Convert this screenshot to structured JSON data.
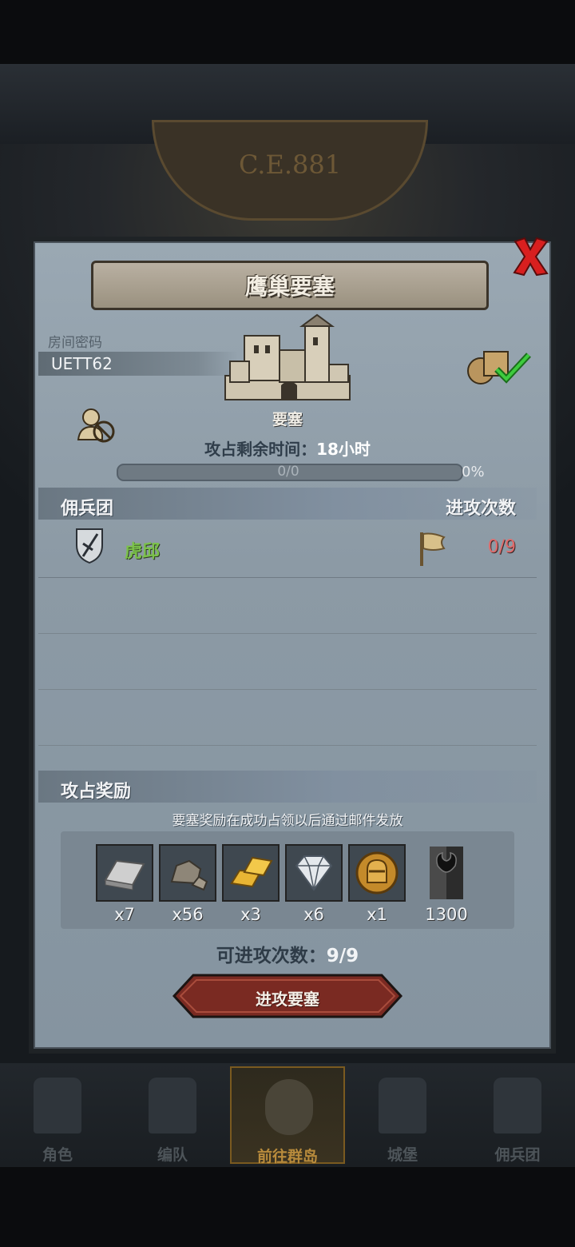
{
  "background": {
    "era_label": "C.E.881"
  },
  "dialog": {
    "title": "鹰巢要塞",
    "room_code_label": "房间密码",
    "room_code": "UETT62",
    "target_name": "要塞",
    "time_left_label": "攻占剩余时间：",
    "time_left_value": "18小时",
    "progress_count": "0/0",
    "progress_percent": "0%",
    "progress_fraction": 0,
    "mercenary_header": "佣兵团",
    "attacks_header": "进攻次数",
    "mercenaries": [
      {
        "name": "虎邱",
        "attacks": "0/9"
      }
    ],
    "rewards_header": "攻占奖励",
    "reward_note": "要塞奖励在成功占领以后通过邮件发放",
    "rewards": [
      {
        "icon": "iron-bar-icon",
        "qty": "x7"
      },
      {
        "icon": "stone-ore-icon",
        "qty": "x56"
      },
      {
        "icon": "gold-bar-icon",
        "qty": "x3"
      },
      {
        "icon": "diamond-icon",
        "qty": "x6"
      },
      {
        "icon": "knight-helmet-coin-icon",
        "qty": "x1"
      },
      {
        "icon": "horned-banner-icon",
        "qty": "1300"
      }
    ],
    "attacks_available_label": "可进攻次数：",
    "attacks_available_value": "9/9",
    "attack_button": "进攻要塞"
  },
  "navbar": {
    "items": [
      {
        "label": "角色",
        "icon": "character-icon"
      },
      {
        "label": "编队",
        "icon": "formation-icon"
      },
      {
        "label": "前往群岛",
        "icon": "archipelago-icon",
        "active": true
      },
      {
        "label": "城堡",
        "icon": "castle-icon"
      },
      {
        "label": "佣兵团",
        "icon": "mercenary-icon"
      }
    ]
  },
  "colors": {
    "mercenary_name": "#7bc14a",
    "attack_count": "#e06a6a",
    "attack_button": "#7a2a22",
    "close_x": "#d81f1f"
  }
}
